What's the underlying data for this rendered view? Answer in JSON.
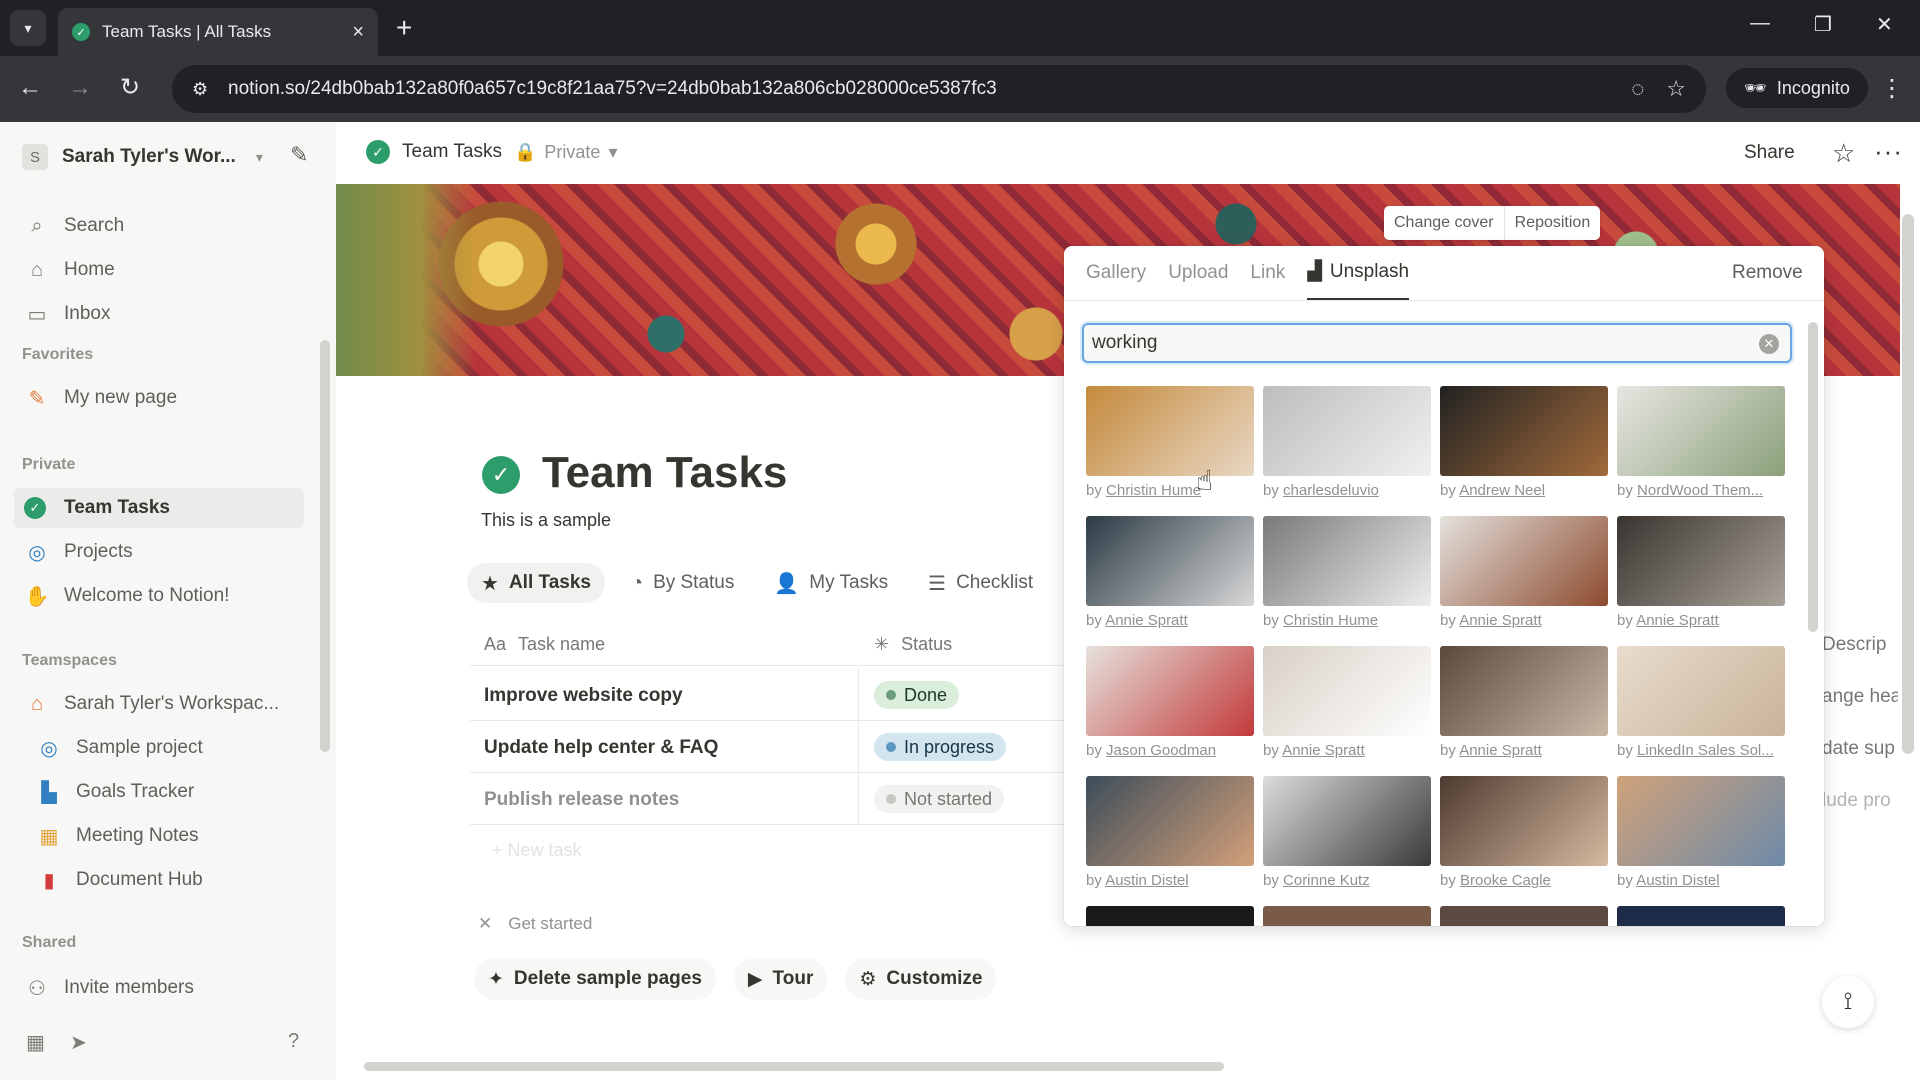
{
  "browser": {
    "tab_title": "Team Tasks | All Tasks",
    "url": "notion.so/24db0bab132a80f0a657c19c8f21aa75?v=24db0bab132a806cb028000ce5387fc3",
    "incognito_label": "Incognito"
  },
  "sidebar": {
    "workspace_initial": "S",
    "workspace_name": "Sarah Tyler's Wor...",
    "top_items": [
      {
        "label": "Search",
        "icon": "search-icon"
      },
      {
        "label": "Home",
        "icon": "home-icon"
      },
      {
        "label": "Inbox",
        "icon": "inbox-icon"
      }
    ],
    "favorites_heading": "Favorites",
    "favorites": [
      {
        "label": "My new page",
        "icon": "pencil-icon"
      }
    ],
    "private_heading": "Private",
    "private_items": [
      {
        "label": "Team Tasks",
        "icon": "check-circle-icon"
      },
      {
        "label": "Projects",
        "icon": "target-icon"
      },
      {
        "label": "Welcome to Notion!",
        "icon": "wave-icon"
      }
    ],
    "teamspaces_heading": "Teamspaces",
    "teamspace_name": "Sarah Tyler's Workspac...",
    "teamspace_items": [
      {
        "label": "Sample project",
        "icon": "target-icon"
      },
      {
        "label": "Goals Tracker",
        "icon": "chart-icon"
      },
      {
        "label": "Meeting Notes",
        "icon": "calendar-icon"
      },
      {
        "label": "Document Hub",
        "icon": "doc-icon"
      }
    ],
    "shared_heading": "Shared",
    "invite_label": "Invite members"
  },
  "topbar": {
    "breadcrumb": "Team Tasks",
    "privacy": "Private",
    "share_label": "Share"
  },
  "cover": {
    "change_cover": "Change cover",
    "reposition": "Reposition"
  },
  "page": {
    "title": "Team Tasks",
    "description": "This is a sample",
    "views": [
      {
        "label": "All Tasks",
        "icon": "star-icon"
      },
      {
        "label": "By Status",
        "icon": "status-icon"
      },
      {
        "label": "My Tasks",
        "icon": "person-icon"
      },
      {
        "label": "Checklist",
        "icon": "checklist-icon"
      }
    ],
    "columns": {
      "task": "Task name",
      "status": "Status",
      "description": "Descrip"
    },
    "rows": [
      {
        "name": "Improve website copy",
        "status": "Done",
        "desc_peek": "ange hea"
      },
      {
        "name": "Update help center & FAQ",
        "status": "In progress",
        "desc_peek": "date sup"
      },
      {
        "name": "Publish release notes",
        "status": "Not started",
        "desc_peek": "lude pro"
      }
    ],
    "new_task": "New task",
    "get_started": "Get started",
    "actions": {
      "delete_samples": "Delete sample pages",
      "tour": "Tour",
      "customize": "Customize"
    }
  },
  "picker": {
    "tabs": [
      "Gallery",
      "Upload",
      "Link",
      "Unsplash"
    ],
    "active_tab": "Unsplash",
    "remove": "Remove",
    "search_value": "working",
    "photos": [
      {
        "author": "Christin Hume",
        "colors": [
          "#c48a3c",
          "#e9d8c4"
        ]
      },
      {
        "author": "charlesdeluvio",
        "colors": [
          "#bdbdbd",
          "#f0f0f0"
        ]
      },
      {
        "author": "Andrew Neel",
        "colors": [
          "#222222",
          "#a06a3a"
        ]
      },
      {
        "author": "NordWood Them...",
        "colors": [
          "#e8e6e2",
          "#8aa07a"
        ]
      },
      {
        "author": "Annie Spratt",
        "colors": [
          "#2b3a44",
          "#d8d8d8"
        ]
      },
      {
        "author": "Christin Hume",
        "colors": [
          "#7a7a7a",
          "#ededed"
        ]
      },
      {
        "author": "Annie Spratt",
        "colors": [
          "#e4e1dd",
          "#8d4b2e"
        ]
      },
      {
        "author": "Annie Spratt",
        "colors": [
          "#3a3430",
          "#a9a29a"
        ]
      },
      {
        "author": "Jason Goodman",
        "colors": [
          "#e6e1dc",
          "#c23a3a"
        ]
      },
      {
        "author": "Annie Spratt",
        "colors": [
          "#d8d0c6",
          "#ffffff"
        ]
      },
      {
        "author": "Annie Spratt",
        "colors": [
          "#5a4a3e",
          "#c9b8a6"
        ]
      },
      {
        "author": "LinkedIn Sales Sol...",
        "colors": [
          "#e8dccd",
          "#c9b39a"
        ]
      },
      {
        "author": "Austin Distel",
        "colors": [
          "#3d4d5a",
          "#d3a07a"
        ]
      },
      {
        "author": "Corinne Kutz",
        "colors": [
          "#dcdcdc",
          "#3a3a3a"
        ]
      },
      {
        "author": "Brooke Cagle",
        "colors": [
          "#4e3b30",
          "#d6b9a0"
        ]
      },
      {
        "author": "Austin Distel",
        "colors": [
          "#cfa27a",
          "#6e8aa8"
        ]
      }
    ],
    "credit_prefix": "by"
  }
}
